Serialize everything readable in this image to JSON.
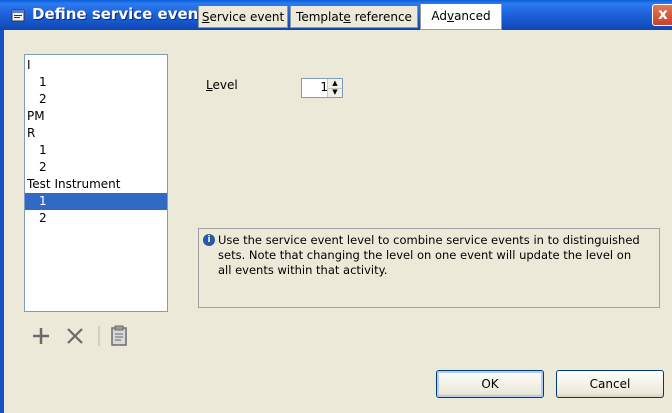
{
  "window": {
    "title": "Define service events",
    "close_label": "x"
  },
  "list": {
    "items": [
      {
        "label": "I",
        "indent": false,
        "selected": false
      },
      {
        "label": "1",
        "indent": true,
        "selected": false
      },
      {
        "label": "2",
        "indent": true,
        "selected": false
      },
      {
        "label": "PM",
        "indent": false,
        "selected": false
      },
      {
        "label": "R",
        "indent": false,
        "selected": false
      },
      {
        "label": "1",
        "indent": true,
        "selected": false
      },
      {
        "label": "2",
        "indent": true,
        "selected": false
      },
      {
        "label": "Test Instrument",
        "indent": false,
        "selected": false
      },
      {
        "label": "1",
        "indent": true,
        "selected": true
      },
      {
        "label": "2",
        "indent": true,
        "selected": false
      }
    ]
  },
  "toolbar": {
    "add_icon": "plus-icon",
    "delete_icon": "x-icon",
    "properties_icon": "document-icon"
  },
  "level": {
    "label_underlined": "L",
    "label_rest": "evel",
    "value": "1"
  },
  "info": {
    "icon": "info-icon",
    "text": "Use the service event level to combine service events in to distinguished sets. Note that changing the level on one event will update the level on all events within that activity."
  },
  "tabs": [
    {
      "label_pre": "",
      "label_u": "S",
      "label_post": "ervice event",
      "active": false
    },
    {
      "label_pre": "Templat",
      "label_u": "e",
      "label_post": " reference",
      "active": false
    },
    {
      "label_pre": "Ad",
      "label_u": "v",
      "label_post": "anced",
      "active": true
    }
  ],
  "buttons": {
    "ok": "OK",
    "cancel": "Cancel"
  }
}
